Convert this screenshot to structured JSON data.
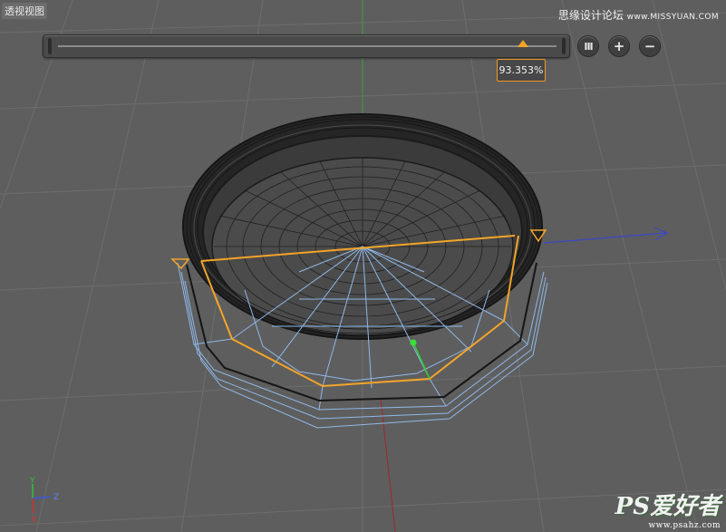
{
  "viewport": {
    "label": "透视视图",
    "background": "#5e5e5e"
  },
  "watermark_top": {
    "text": "思缘设计论坛",
    "url": "www.MISSYUAN.COM"
  },
  "slider": {
    "value_fraction": 0.93353,
    "tooltip": "93.353%",
    "accent": "#f4a428"
  },
  "buttons": {
    "pause_icon": "pause-bars-icon",
    "pause_label": "III",
    "plus_label": "+",
    "minus_label": "−"
  },
  "axis": {
    "y_label": "Y",
    "z_label": "Z",
    "x_label": "X"
  },
  "watermark_bottom": {
    "text": "PS爱好者",
    "url": "www.psahz.com"
  },
  "colors": {
    "grid": "#6a6a6a",
    "mesh_dark": "#1b1b1b",
    "mesh_selected": "#8fb8e8",
    "selection_edge": "#f4a428",
    "axis_x": "#b03030",
    "axis_y": "#30a030",
    "axis_z": "#3040c0"
  }
}
